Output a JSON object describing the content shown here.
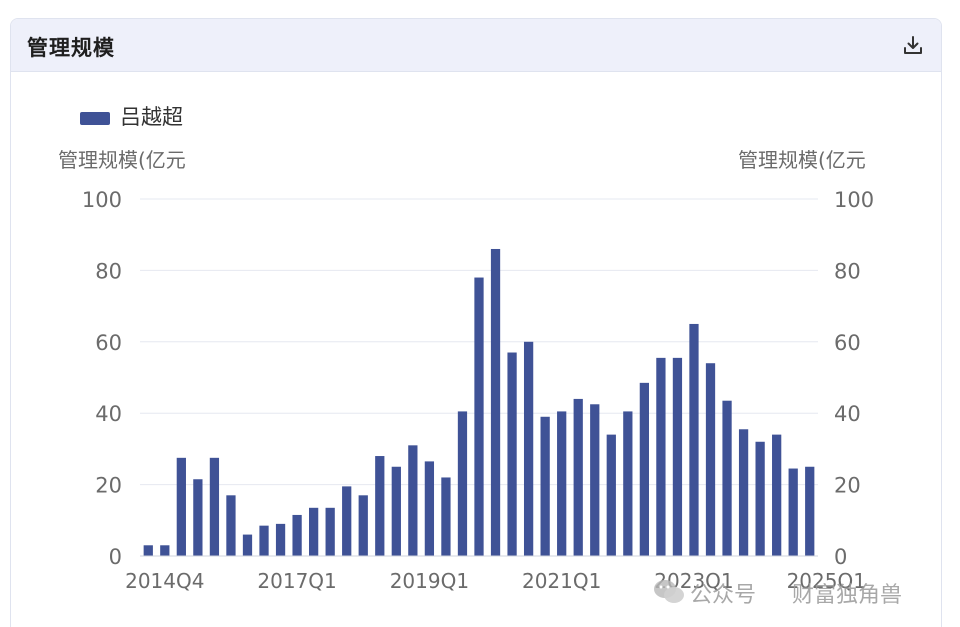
{
  "panel": {
    "title": "管理规模",
    "download_icon": "download-icon"
  },
  "watermark": {
    "channel_label": "公众号",
    "account_name": "财富独角兽",
    "icon": "wechat-icon"
  },
  "colors": {
    "bar": "#3f5296",
    "grid": "#e6e8f0",
    "axis_text": "#6b6b6b",
    "header_bg": "#eef0fa"
  },
  "chart_data": {
    "type": "bar",
    "legend": [
      "吕越超"
    ],
    "legend_position": "top-left",
    "y_axis_left_label": "管理规模(亿元",
    "y_axis_right_label": "管理规模(亿元",
    "ylim": [
      0,
      100
    ],
    "y_ticks": [
      0,
      20,
      40,
      60,
      80,
      100
    ],
    "grid": true,
    "x_tick_labels": [
      "2014Q4",
      "2017Q1",
      "2019Q1",
      "2021Q1",
      "2023Q1",
      "2025Q1"
    ],
    "x_tick_indices": [
      1,
      9,
      17,
      25,
      33,
      41
    ],
    "series": [
      {
        "name": "吕越超",
        "values": [
          3,
          3,
          27.5,
          21.5,
          27.5,
          17,
          6,
          8.5,
          9,
          11.5,
          13.5,
          13.5,
          19.5,
          17,
          28,
          25,
          31,
          26.5,
          22,
          40.5,
          78,
          86,
          57,
          60,
          39,
          40.5,
          44,
          42.5,
          34,
          40.5,
          48.5,
          55.5,
          55.5,
          65,
          54,
          43.5,
          35.5,
          32,
          34,
          24.5,
          25
        ]
      }
    ]
  }
}
